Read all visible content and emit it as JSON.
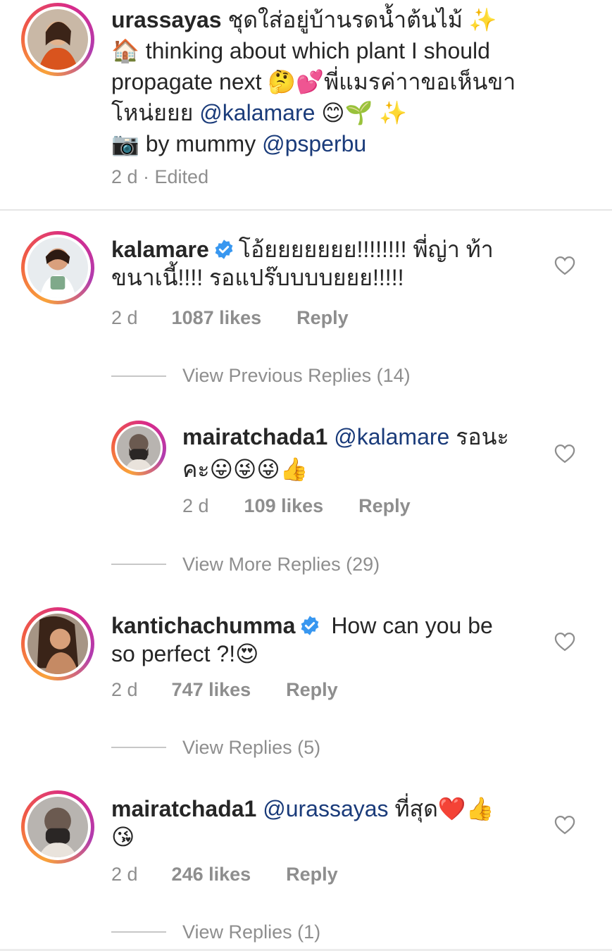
{
  "caption": {
    "username": "urassayas",
    "line1": " ชุดใส่อยู่บ้านรดน้ำต้นไม้ ✨",
    "line2": "🏠 thinking about which plant I should",
    "line3": "propagate next 🤔💕พี่แมรค่าาขอเห็นขา",
    "line4_pre": "โหน่ยยย ",
    "line4_mention": "@kalamare",
    "line4_post": " 😊🌱 ✨",
    "line5_pre": "📷 by mummy ",
    "line5_mention": "@psperbu",
    "meta": "2 d · Edited"
  },
  "comments": [
    {
      "username": "kalamare",
      "text_line1": "โอ้ยยยยยยย!!!!!!!! พี่ญ่า ท้า",
      "text_line2": "ขนาเนี้!!!! รอแปร๊บบบบยยย!!!!!",
      "time": "2 d",
      "likes": "1087 likes",
      "reply": "Reply",
      "view_replies": "View Previous Replies (14)"
    },
    {
      "username": "mairatchada1",
      "mention": "@kalamare",
      "text_line1": " รอนะ",
      "text_line2": "คะ😛😜😜👍",
      "time": "2 d",
      "likes": "109 likes",
      "reply": "Reply",
      "view_replies": "View More Replies (29)"
    },
    {
      "username": "kantichachumma",
      "text_line1": " How can you be",
      "text_line2": "so perfect ?!😍",
      "time": "2 d",
      "likes": "747 likes",
      "reply": "Reply",
      "view_replies": "View Replies (5)"
    },
    {
      "username": "mairatchada1",
      "mention": "@urassayas",
      "text_line1": "  ที่สุด❤️👍",
      "text_line2": "😘",
      "time": "2 d",
      "likes": "246 likes",
      "reply": "Reply",
      "view_replies": "View Replies (1)"
    }
  ],
  "colors": {
    "text": "#262626",
    "muted": "#8e8e8e",
    "mention": "#1a3b7a",
    "verified": "#3897f0"
  },
  "icons": [
    "verified-badge-icon",
    "heart-outline-icon"
  ]
}
